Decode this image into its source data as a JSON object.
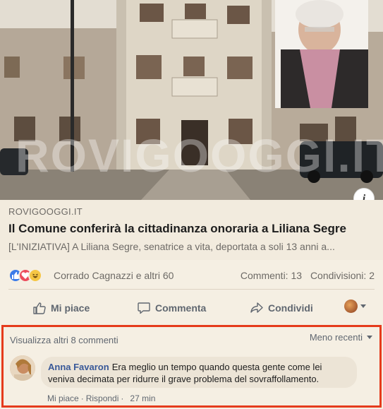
{
  "hero": {
    "watermark": "ROVIGOOGGI.IT",
    "info_label": "i"
  },
  "link": {
    "source": "ROVIGOOGGI.IT",
    "title": "Il Comune conferirà la cittadinanza onoraria a Liliana Segre",
    "description": "[L'INIZIATIVA] A Liliana Segre, senatrice a vita, deportata a soli 13 anni a..."
  },
  "reactions": {
    "names": "Corrado Cagnazzi e altri 60",
    "comments": "Commenti: 13",
    "shares": "Condivisioni: 2",
    "icons": [
      "like-icon",
      "love-icon",
      "haha-icon"
    ],
    "colors": {
      "like": "#3b7be8",
      "love": "#ec4d5c",
      "haha": "#f6c644"
    }
  },
  "actions": {
    "like": "Mi piace",
    "comment": "Commenta",
    "share": "Condividi"
  },
  "comments": {
    "view_more": "Visualizza altri 8 commenti",
    "sort": "Meno recenti",
    "highlight_color": "#e53b1c",
    "items": [
      {
        "author": "Anna Favaron",
        "text": "Era meglio un tempo quando questa gente come lei veniva decimata per ridurre il grave problema del sovraffollamento.",
        "like": "Mi piace",
        "reply": "Rispondi",
        "time": "27 min"
      }
    ]
  }
}
